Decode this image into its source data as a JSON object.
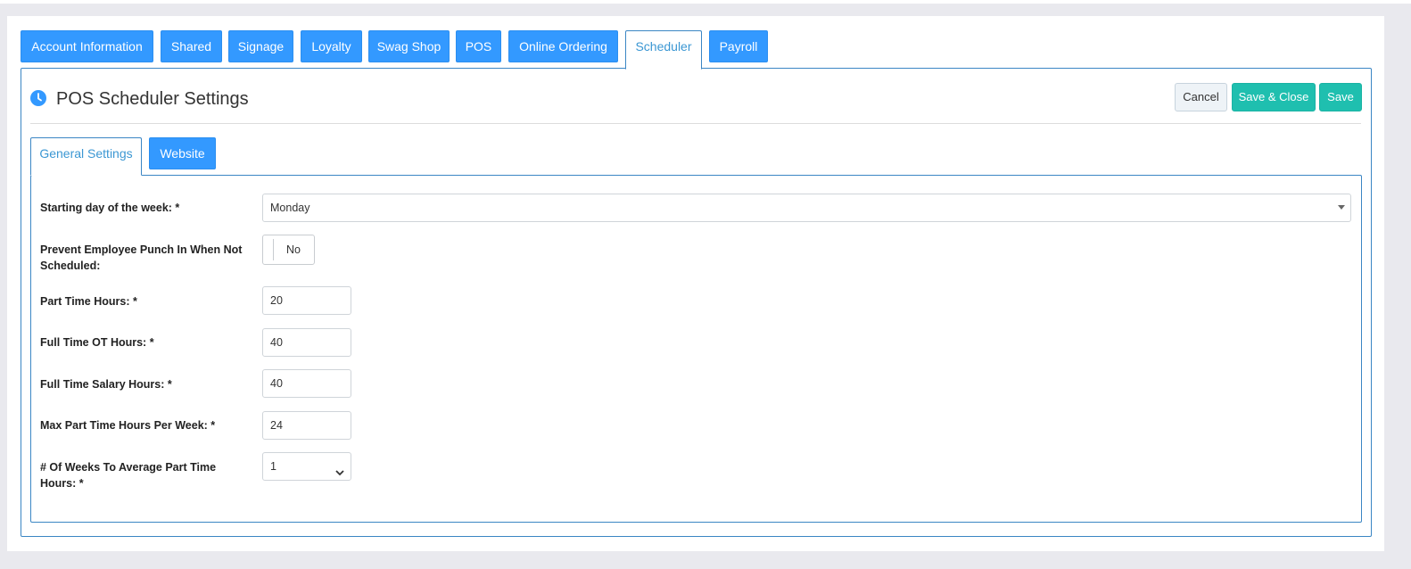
{
  "top_tabs": [
    {
      "label": "Account Information",
      "active": false
    },
    {
      "label": "Shared",
      "active": false
    },
    {
      "label": "Signage",
      "active": false
    },
    {
      "label": "Loyalty",
      "active": false
    },
    {
      "label": "Swag Shop",
      "active": false
    },
    {
      "label": "POS",
      "active": false
    },
    {
      "label": "Online Ordering",
      "active": false
    },
    {
      "label": "Scheduler",
      "active": true
    },
    {
      "label": "Payroll",
      "active": false
    }
  ],
  "header": {
    "title": "POS Scheduler Settings",
    "icon": "clock-icon",
    "cancel_label": "Cancel",
    "save_close_label": "Save & Close",
    "save_label": "Save"
  },
  "inner_tabs": [
    {
      "label": "General Settings",
      "active": true
    },
    {
      "label": "Website",
      "active": false
    }
  ],
  "form": {
    "starting_day": {
      "label": "Starting day of the week: *",
      "value": "Monday"
    },
    "prevent_punch": {
      "label": "Prevent Employee Punch In When Not Scheduled:",
      "value": "No"
    },
    "part_time_hours": {
      "label": "Part Time Hours: *",
      "value": "20"
    },
    "full_time_ot_hours": {
      "label": "Full Time OT Hours: *",
      "value": "40"
    },
    "full_time_salary_hours": {
      "label": "Full Time Salary Hours: *",
      "value": "40"
    },
    "max_part_time_hours": {
      "label": "Max Part Time Hours Per Week: *",
      "value": "24"
    },
    "weeks_to_average": {
      "label": "# Of Weeks To Average Part Time Hours: *",
      "value": "1"
    }
  },
  "colors": {
    "primary_blue": "#3399ff",
    "teal": "#1fbfaf",
    "active_tab_text": "#3b97d3"
  }
}
